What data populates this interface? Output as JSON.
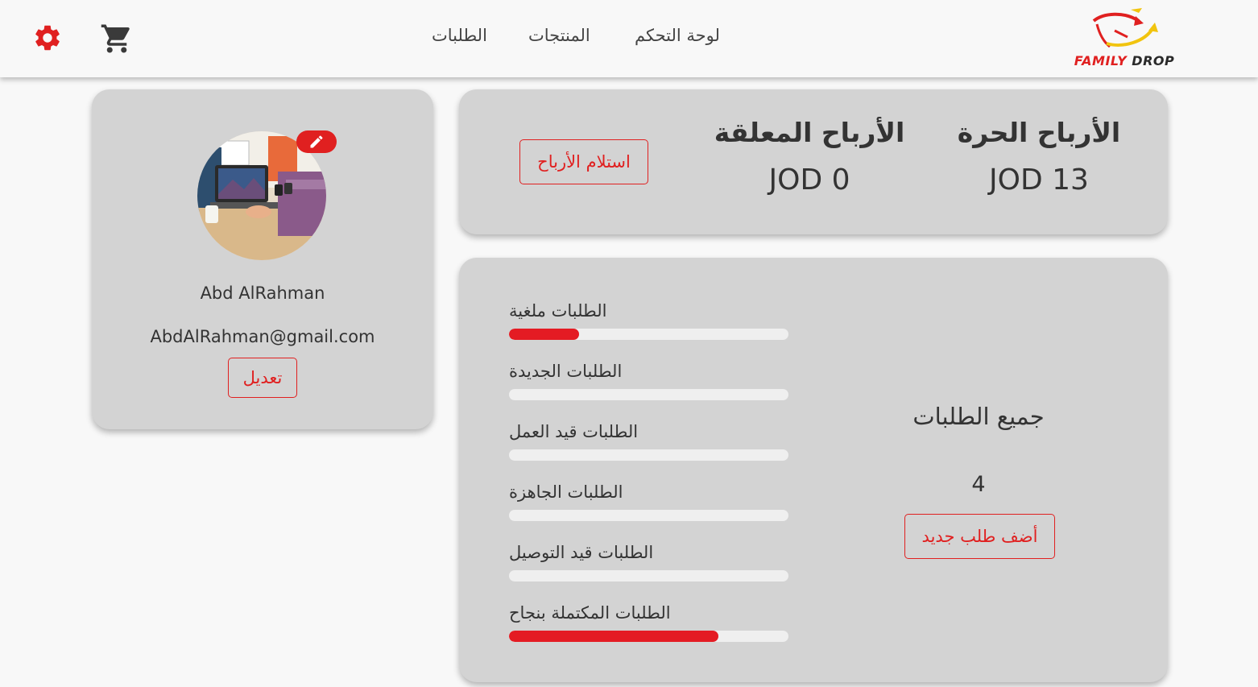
{
  "header": {
    "nav": {
      "dashboard": "لوحة التحكم",
      "products": "المنتجات",
      "orders": "الطلبات"
    },
    "logo": {
      "family": "FAMILY",
      "drop": "DROP"
    },
    "icons": {
      "settings": "gear-icon",
      "cart": "cart-icon"
    }
  },
  "profile": {
    "name": "Abd AlRahman",
    "email": "AbdAlRahman@gmail.com",
    "edit_label": "تعديل"
  },
  "earnings": {
    "free_title": "الأرباح الحرة",
    "free_value": "JOD 13",
    "pending_title": "الأرباح المعلقة",
    "pending_value": "JOD 0",
    "withdraw_label": "استلام الأرباح"
  },
  "orders": {
    "total_title": "جميع الطلبات",
    "total_count": "4",
    "add_label": "أضف طلب جديد",
    "bars": [
      {
        "label": "الطلبات ملغية",
        "fraction": 0.25
      },
      {
        "label": "الطلبات الجديدة",
        "fraction": 0
      },
      {
        "label": "الطلبات قيد العمل",
        "fraction": 0
      },
      {
        "label": "الطلبات الجاهزة",
        "fraction": 0
      },
      {
        "label": "الطلبات قيد التوصيل",
        "fraction": 0
      },
      {
        "label": "الطلبات المكتملة بنجاح",
        "fraction": 0.75
      }
    ]
  },
  "colors": {
    "accent": "#e41b23",
    "card": "#d3d3d3",
    "background": "#f8f8f8"
  }
}
